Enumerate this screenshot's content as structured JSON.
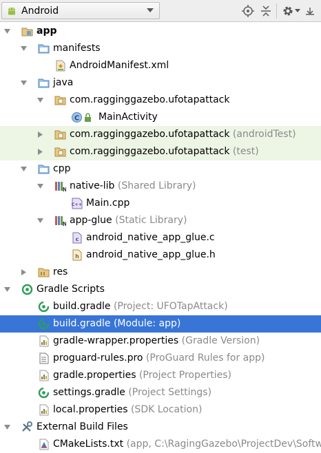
{
  "toolbar": {
    "view_label": "Android",
    "icons": [
      "android-icon",
      "dropdown-caret-icon",
      "locate-icon",
      "collapse-all-icon",
      "gear-icon",
      "hide-icon"
    ]
  },
  "tree": [
    {
      "label": "app",
      "suffix": "",
      "icon": "module-folder-icon",
      "state": "expanded"
    },
    {
      "label": "manifests",
      "suffix": "",
      "icon": "folder-icon",
      "state": "expanded"
    },
    {
      "label": "AndroidManifest.xml",
      "suffix": "",
      "icon": "xml-file-icon",
      "state": "leaf"
    },
    {
      "label": "java",
      "suffix": "",
      "icon": "folder-icon",
      "state": "expanded"
    },
    {
      "label": "com.ragginggazebo.ufotapattack",
      "suffix": "",
      "icon": "package-icon",
      "state": "expanded"
    },
    {
      "label": "MainActivity",
      "suffix": "",
      "icon": "class-icon",
      "state": "leaf"
    },
    {
      "label": "com.ragginggazebo.ufotapattack",
      "suffix": "(androidTest)",
      "icon": "package-icon",
      "state": "collapsed"
    },
    {
      "label": "com.ragginggazebo.ufotapattack",
      "suffix": "(test)",
      "icon": "package-icon",
      "state": "collapsed"
    },
    {
      "label": "cpp",
      "suffix": "",
      "icon": "folder-icon",
      "state": "expanded"
    },
    {
      "label": "native-lib",
      "suffix": "(Shared Library)",
      "icon": "library-icon",
      "state": "expanded"
    },
    {
      "label": "Main.cpp",
      "suffix": "",
      "icon": "cpp-file-icon",
      "state": "leaf"
    },
    {
      "label": "app-glue",
      "suffix": "(Static Library)",
      "icon": "library-icon",
      "state": "expanded"
    },
    {
      "label": "android_native_app_glue.c",
      "suffix": "",
      "icon": "c-file-icon",
      "state": "leaf"
    },
    {
      "label": "android_native_app_glue.h",
      "suffix": "",
      "icon": "h-file-icon",
      "state": "leaf"
    },
    {
      "label": "res",
      "suffix": "",
      "icon": "res-folder-icon",
      "state": "collapsed"
    },
    {
      "label": "Gradle Scripts",
      "suffix": "",
      "icon": "gradle-icon",
      "state": "expanded"
    },
    {
      "label": "build.gradle",
      "suffix": "(Project: UFOTapAttack)",
      "icon": "gradle-file-icon",
      "state": "leaf"
    },
    {
      "label": "build.gradle",
      "suffix": "(Module: app)",
      "icon": "gradle-file-icon",
      "state": "leaf"
    },
    {
      "label": "gradle-wrapper.properties",
      "suffix": "(Gradle Version)",
      "icon": "properties-file-icon",
      "state": "leaf"
    },
    {
      "label": "proguard-rules.pro",
      "suffix": "(ProGuard Rules for app)",
      "icon": "text-file-icon",
      "state": "leaf"
    },
    {
      "label": "gradle.properties",
      "suffix": "(Project Properties)",
      "icon": "properties-file-icon",
      "state": "leaf"
    },
    {
      "label": "settings.gradle",
      "suffix": "(Project Settings)",
      "icon": "gradle-file-icon",
      "state": "leaf"
    },
    {
      "label": "local.properties",
      "suffix": "(SDK Location)",
      "icon": "properties-file-icon",
      "state": "leaf"
    },
    {
      "label": "External Build Files",
      "suffix": "",
      "icon": "external-build-icon",
      "state": "expanded"
    },
    {
      "label": "CMakeLists.txt",
      "suffix": "(app, C:\\RagingGazebo\\ProjectDev\\Softwa",
      "icon": "cmake-file-icon",
      "state": "leaf"
    }
  ],
  "selected_index": 17,
  "highlighted_indices": [
    6,
    7
  ],
  "colors": {
    "selection": "#3875d7",
    "highlight_rows": "#edf5e5",
    "suffix_text": "#8a8a8a",
    "toolbar_bg": "#eeeeee"
  }
}
